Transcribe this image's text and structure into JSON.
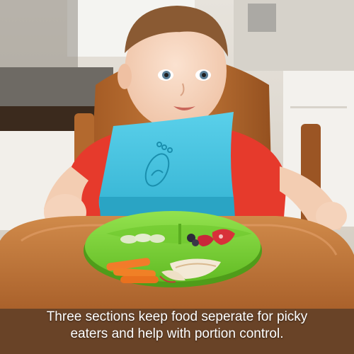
{
  "photo": {
    "caption_line_1": "Three sections keep food seperate for picky",
    "caption_line_2": "eaters and help with portion control.",
    "colors": {
      "bib": "#44c4e0",
      "plate": "#7ed63a",
      "shirt": "#e63a2c",
      "tray_wood": "#c67c3d",
      "text": "#ffffff"
    }
  }
}
